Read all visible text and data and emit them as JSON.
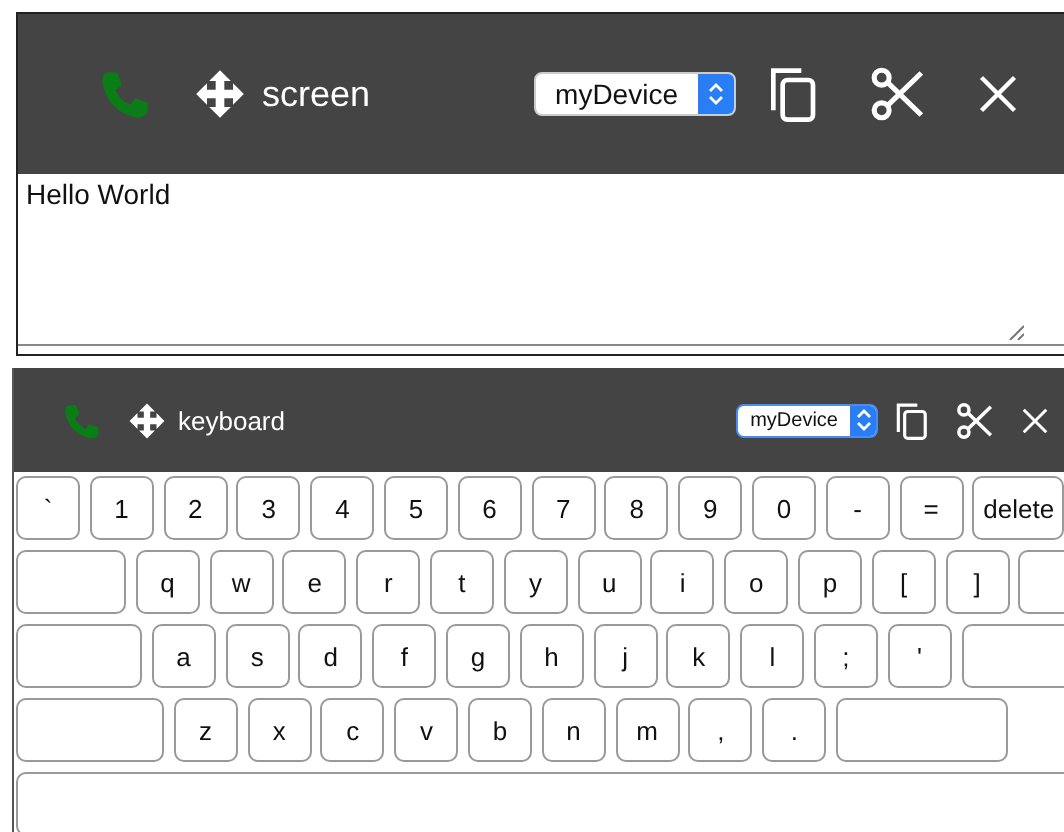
{
  "panels": [
    {
      "kind": "screen",
      "title": "screen",
      "device": "myDevice",
      "text": "Hello World"
    },
    {
      "kind": "keyboard",
      "title": "keyboard",
      "device": "myDevice",
      "rows": [
        [
          {
            "kind": "key",
            "label": "`"
          },
          {
            "kind": "key",
            "label": "1"
          },
          {
            "kind": "key",
            "label": "2"
          },
          {
            "kind": "key",
            "label": "3"
          },
          {
            "kind": "key",
            "label": "4"
          },
          {
            "kind": "key",
            "label": "5"
          },
          {
            "kind": "key",
            "label": "6"
          },
          {
            "kind": "key",
            "label": "7"
          },
          {
            "kind": "key",
            "label": "8"
          },
          {
            "kind": "key",
            "label": "9"
          },
          {
            "kind": "key",
            "label": "0"
          },
          {
            "kind": "key",
            "label": "-"
          },
          {
            "kind": "key",
            "label": "="
          },
          {
            "kind": "delete",
            "label": "delete"
          }
        ],
        [
          {
            "kind": "tab"
          },
          {
            "kind": "key",
            "label": "q"
          },
          {
            "kind": "key",
            "label": "w"
          },
          {
            "kind": "key",
            "label": "e"
          },
          {
            "kind": "key",
            "label": "r"
          },
          {
            "kind": "key",
            "label": "t"
          },
          {
            "kind": "key",
            "label": "y"
          },
          {
            "kind": "key",
            "label": "u"
          },
          {
            "kind": "key",
            "label": "i"
          },
          {
            "kind": "key",
            "label": "o"
          },
          {
            "kind": "key",
            "label": "p"
          },
          {
            "kind": "key",
            "label": "["
          },
          {
            "kind": "key",
            "label": "]"
          },
          {
            "kind": "backslash"
          }
        ],
        [
          {
            "kind": "caps"
          },
          {
            "kind": "key",
            "label": "a"
          },
          {
            "kind": "key",
            "label": "s"
          },
          {
            "kind": "key",
            "label": "d"
          },
          {
            "kind": "key",
            "label": "f"
          },
          {
            "kind": "key",
            "label": "g"
          },
          {
            "kind": "key",
            "label": "h"
          },
          {
            "kind": "key",
            "label": "j"
          },
          {
            "kind": "key",
            "label": "k"
          },
          {
            "kind": "key",
            "label": "l"
          },
          {
            "kind": "key",
            "label": ";"
          },
          {
            "kind": "key",
            "label": "'"
          },
          {
            "kind": "enter"
          }
        ],
        [
          {
            "kind": "shift"
          },
          {
            "kind": "key",
            "label": "z"
          },
          {
            "kind": "key",
            "label": "x"
          },
          {
            "kind": "key",
            "label": "c"
          },
          {
            "kind": "key",
            "label": "v"
          },
          {
            "kind": "key",
            "label": "b"
          },
          {
            "kind": "key",
            "label": "n"
          },
          {
            "kind": "key",
            "label": "m"
          },
          {
            "kind": "key",
            "label": ","
          },
          {
            "kind": "key",
            "label": "."
          },
          {
            "kind": "shift-right"
          }
        ],
        [
          {
            "kind": "space"
          }
        ]
      ]
    }
  ]
}
